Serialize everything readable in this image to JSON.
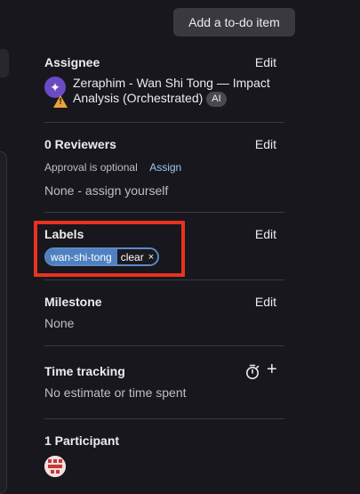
{
  "tooltip": {
    "text": "Add a to-do item"
  },
  "assignee": {
    "title": "Assignee",
    "edit_label": "Edit",
    "name": "Zeraphim - Wan Shi Tong — Impact Analysis (Orchestrated)",
    "badge": "AI",
    "avatar_icon": "sparkle-icon",
    "warning_icon": "warning-icon"
  },
  "reviewers": {
    "title": "0 Reviewers",
    "edit_label": "Edit",
    "approval_text": "Approval is optional",
    "assign_label": "Assign",
    "none_text": "None - assign yourself"
  },
  "labels": {
    "title": "Labels",
    "edit_label": "Edit",
    "items": [
      {
        "key": "wan-shi-tong",
        "value": "clear",
        "remove": "×"
      }
    ],
    "highlight_color": "#e8321f"
  },
  "milestone": {
    "title": "Milestone",
    "edit_label": "Edit",
    "value": "None"
  },
  "time_tracking": {
    "title": "Time tracking",
    "value": "No estimate or time spent",
    "add_label": "+"
  },
  "participants": {
    "title": "1 Participant"
  }
}
